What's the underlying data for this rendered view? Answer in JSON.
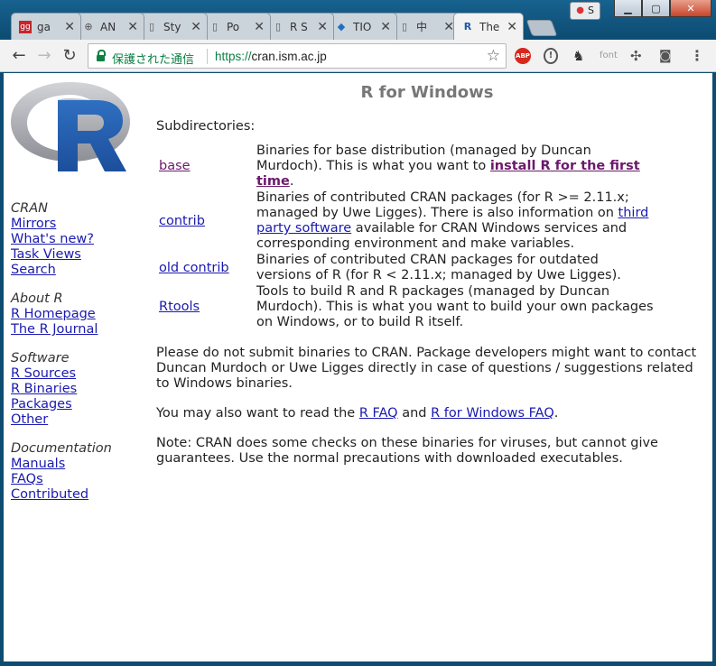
{
  "browser": {
    "profile_name": "S",
    "tabs": [
      {
        "icon": "gg-icon",
        "glyph": "gg",
        "label": "ga"
      },
      {
        "icon": "h-circle-icon",
        "glyph": "⊕",
        "label": "AN"
      },
      {
        "icon": "document-icon",
        "glyph": "▯",
        "label": "Sty"
      },
      {
        "icon": "document-icon",
        "glyph": "▯",
        "label": "Po"
      },
      {
        "icon": "document-icon",
        "glyph": "▯",
        "label": "R S"
      },
      {
        "icon": "tio-diamond-icon",
        "glyph": "◆",
        "label": "TIO"
      },
      {
        "icon": "document-icon",
        "glyph": "▯",
        "label": "中"
      },
      {
        "icon": "r-logo-icon",
        "glyph": "R",
        "label": "The"
      }
    ],
    "address": {
      "secure_label": "保護された通信",
      "scheme": "https://",
      "host": "cran.ism.ac.jp"
    },
    "extensions": [
      "abp-icon",
      "info-circle-icon",
      "evernote-icon",
      "font-icon",
      "gear-plugin-icon",
      "camera-icon",
      "menu-icon"
    ],
    "extension_labels": {
      "abp": "ABP",
      "font": "font"
    }
  },
  "sidebar": {
    "groups": [
      {
        "heading": "CRAN",
        "links": [
          "Mirrors",
          "What's new?",
          "Task Views",
          "Search"
        ]
      },
      {
        "heading": "About R",
        "links": [
          "R Homepage",
          "The R Journal"
        ]
      },
      {
        "heading": "Software",
        "links": [
          "R Sources",
          "R Binaries",
          "Packages",
          "Other"
        ]
      },
      {
        "heading": "Documentation",
        "links": [
          "Manuals",
          "FAQs",
          "Contributed"
        ]
      }
    ]
  },
  "main": {
    "title": "R for Windows",
    "subdirectories_label": "Subdirectories:",
    "subdirs": [
      {
        "dir": "base",
        "desc": "Binaries for base distribution (managed by Duncan Murdoch). This is what you want to ",
        "link": "install R for the first time",
        "desc_after": "."
      },
      {
        "dir": "contrib",
        "desc": "Binaries of contributed CRAN packages (for R >= 2.11.x; managed by Uwe Ligges). There is also information on ",
        "link": "third party software",
        "desc_after": " available for CRAN Windows services and corresponding environment and make variables."
      },
      {
        "dir": "old contrib",
        "desc": "Binaries of contributed CRAN packages for outdated versions of R (for R < 2.11.x; managed by Uwe Ligges).",
        "link": "",
        "desc_after": ""
      },
      {
        "dir": "Rtools",
        "desc": "Tools to build R and R packages (managed by Duncan Murdoch). This is what you want to build your own packages on Windows, or to build R itself.",
        "link": "",
        "desc_after": ""
      }
    ],
    "para_submit": "Please do not submit binaries to CRAN. Package developers might want to contact Duncan Murdoch or Uwe Ligges directly in case of questions / suggestions related to Windows binaries.",
    "para_faq": {
      "before": "You may also want to read the ",
      "link1": "R FAQ",
      "middle": " and ",
      "link2": "R for Windows FAQ",
      "after": "."
    },
    "para_note": "Note: CRAN does some checks on these binaries for viruses, but cannot give guarantees. Use the normal precautions with downloaded executables."
  }
}
